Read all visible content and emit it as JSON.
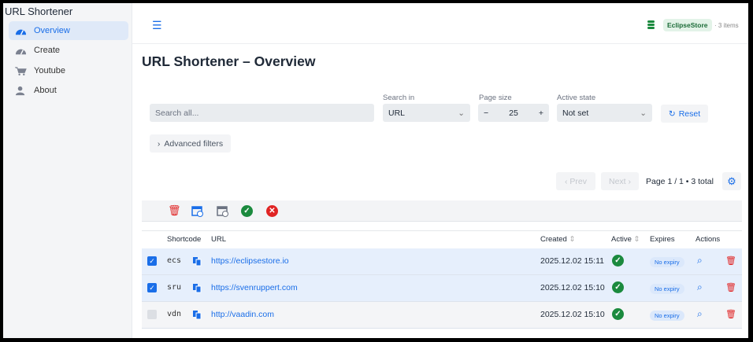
{
  "app_title": "URL Shortener",
  "sidebar": {
    "items": [
      {
        "label": "Overview",
        "icon": "dashboard-icon",
        "active": true
      },
      {
        "label": "Create",
        "icon": "dashboard-icon"
      },
      {
        "label": "Youtube",
        "icon": "cart-icon"
      },
      {
        "label": "About",
        "icon": "user-icon"
      }
    ]
  },
  "header": {
    "store_badge": "EclipseStore",
    "item_count": "· 3 items"
  },
  "page_title": "URL Shortener – Overview",
  "filters": {
    "search_placeholder": "Search all...",
    "search_in_label": "Search in",
    "search_in_value": "URL",
    "page_size_label": "Page size",
    "page_size_value": "25",
    "active_state_label": "Active state",
    "active_state_value": "Not set",
    "reset_label": "Reset",
    "advanced_label": "Advanced filters"
  },
  "pagination": {
    "prev": "‹ Prev",
    "next": "Next ›",
    "info": "Page 1 / 1 • 3 total"
  },
  "table": {
    "columns": {
      "shortcode": "Shortcode",
      "url": "URL",
      "created": "Created",
      "active": "Active",
      "expires": "Expires",
      "actions": "Actions"
    },
    "rows": [
      {
        "selected": true,
        "shortcode": "ecs",
        "url": "https://eclipsestore.io",
        "created": "2025.12.02 15:11",
        "active": true,
        "expires": "No expiry"
      },
      {
        "selected": true,
        "shortcode": "sru",
        "url": "https://svenruppert.com",
        "created": "2025.12.02 15:10",
        "active": true,
        "expires": "No expiry"
      },
      {
        "selected": false,
        "shortcode": "vdn",
        "url": "http://vaadin.com",
        "created": "2025.12.02 15:10",
        "active": true,
        "expires": "No expiry"
      }
    ]
  },
  "colors": {
    "accent": "#1a6ee8",
    "success": "#1b8a3e",
    "danger": "#e02424"
  }
}
